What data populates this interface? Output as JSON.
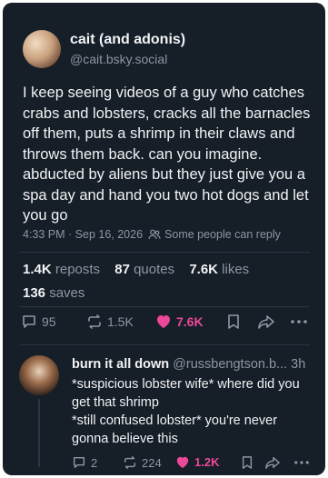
{
  "post": {
    "author_name": "cait (and adonis)",
    "author_handle": "@cait.bsky.social",
    "text": "I keep seeing videos of a guy who catches crabs and lobsters, cracks all the barnacles off them, puts a shrimp in their claws and throws them back. can you imagine. abducted by aliens but they just give you a spa day and hand you two hot dogs and let you go",
    "timestamp": "4:33 PM · Sep 16, 2026",
    "audience_icon": "people-icon",
    "audience": "Some people can reply",
    "reposts_count": "1.4K",
    "reposts_label": "reposts",
    "quotes_count": "87",
    "quotes_label": "quotes",
    "likes_count": "7.6K",
    "likes_label": "likes",
    "saves_count": "136",
    "saves_label": "saves",
    "actions": {
      "reply_count": "95",
      "repost_count": "1.5K",
      "like_count": "7.6K"
    }
  },
  "reply": {
    "author_name": "burn it all down",
    "author_handle": "@russbengtson.b...",
    "time": "3h",
    "text": "*suspicious lobster wife* where did you get that shrimp\n*still confused lobster* you're never gonna believe this",
    "actions": {
      "reply_count": "2",
      "repost_count": "224",
      "like_count": "1.2K"
    }
  },
  "colors": {
    "background": "#161e27",
    "text": "#f1f3f5",
    "muted": "#8b98a5",
    "like": "#ec4899",
    "divider": "#2b3642"
  }
}
